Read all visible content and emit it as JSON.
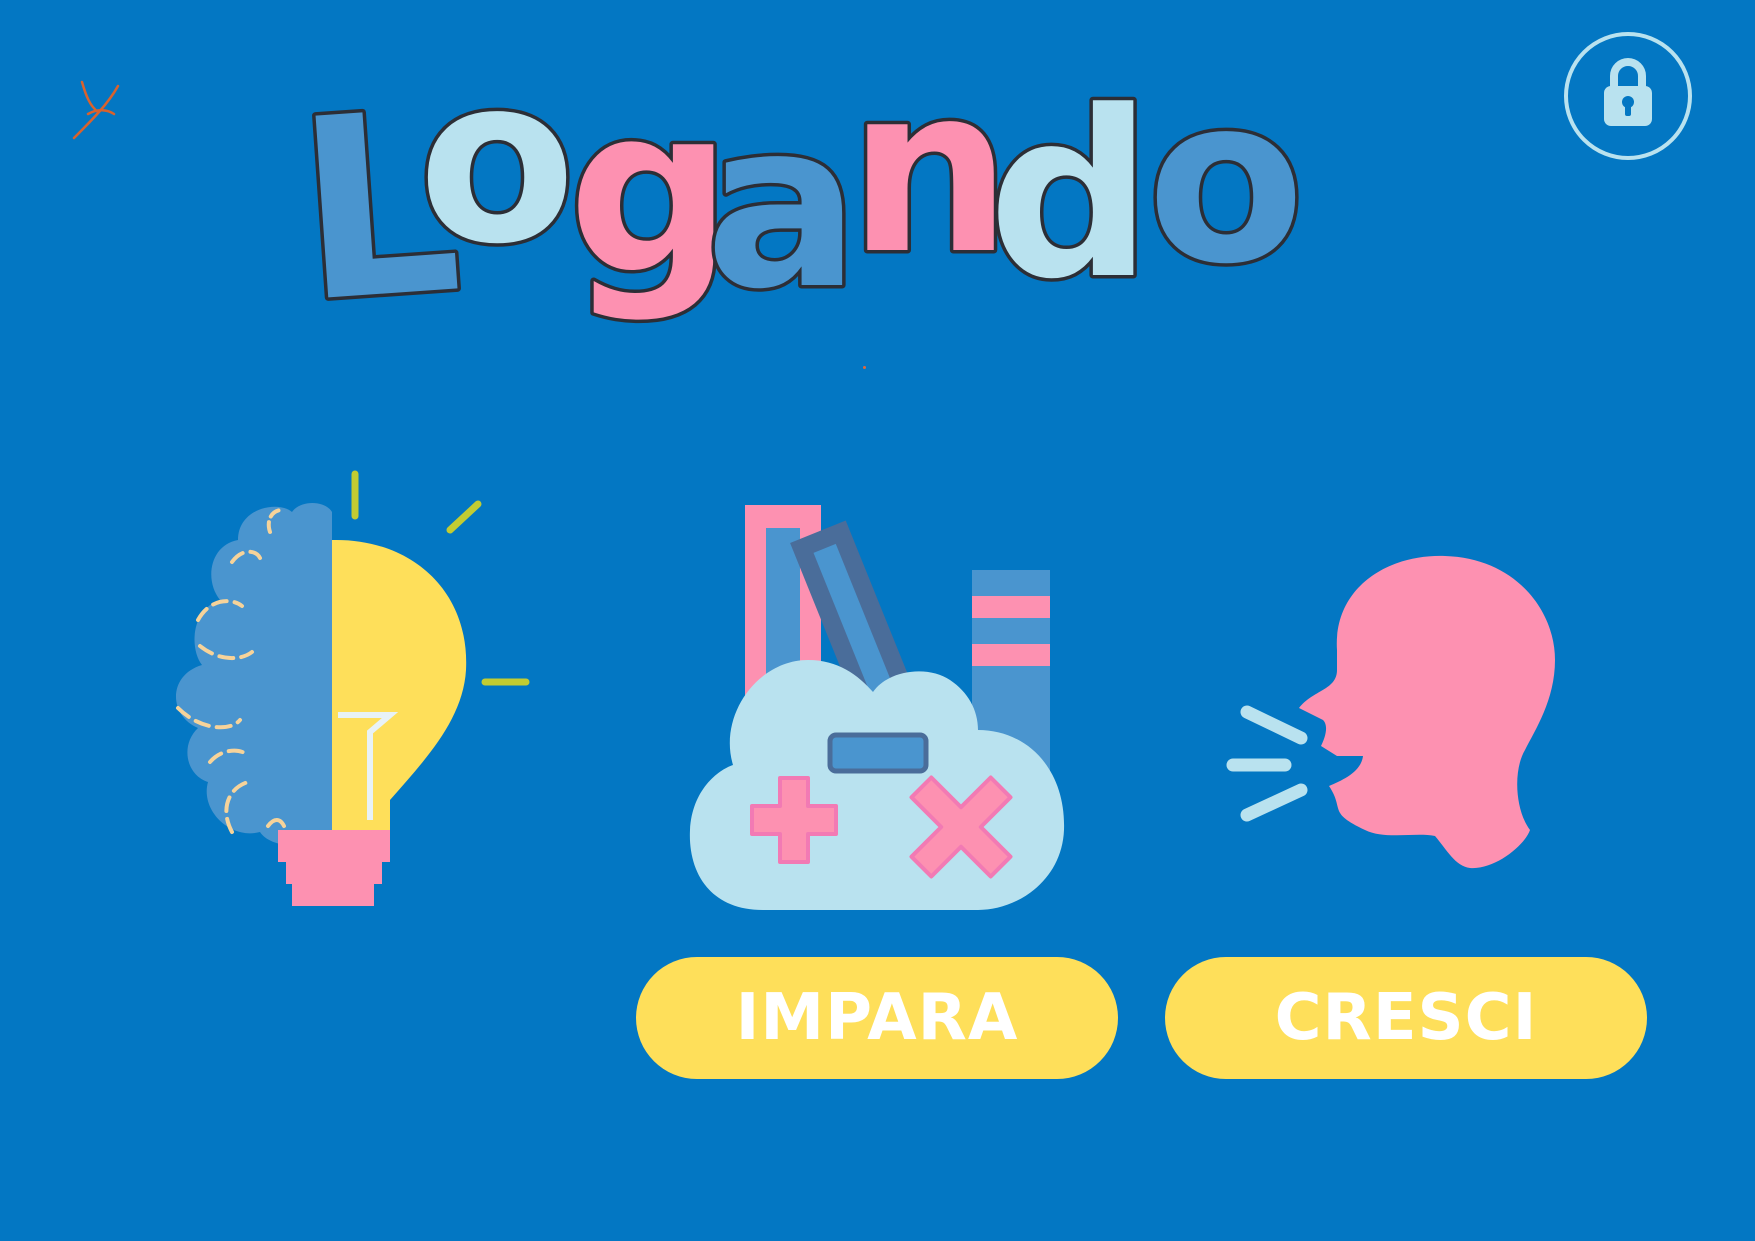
{
  "app": {
    "title": "Logando"
  },
  "buttons": {
    "impara_label": "IMPARA",
    "cresci_label": "CRESCI"
  },
  "icons": {
    "lock": "lock-icon",
    "corner_mark": "scribble-mark",
    "brain_bulb": "brain-lightbulb-illustration",
    "books_game": "books-gamepad-illustration",
    "speaking_head": "speaking-head-illustration"
  },
  "colors": {
    "background": "#0377c3",
    "button": "#fedf5a",
    "button_text": "#ffffff",
    "pink": "#fd91b1",
    "light_blue": "#b9e2ef",
    "mid_blue": "#4a95cf",
    "yellow": "#fedf5a"
  }
}
